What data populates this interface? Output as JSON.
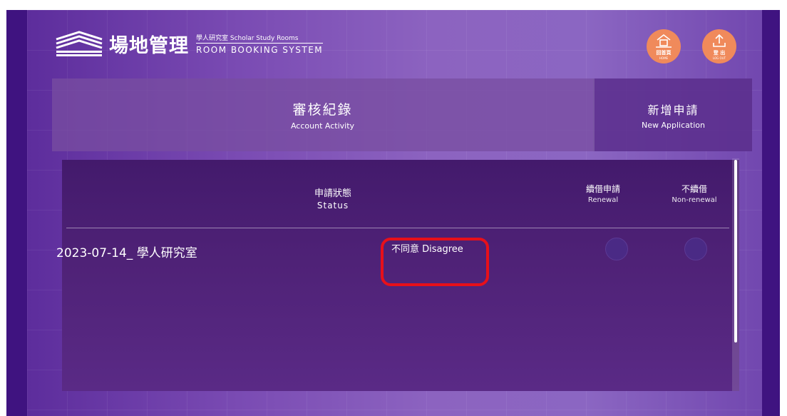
{
  "header": {
    "logo_title": "場地管理",
    "logo_subtitle": "學人研究室 Scholar Study Rooms",
    "logo_system": "ROOM BOOKING SYSTEM",
    "home_label": "回首頁",
    "home_sub": "HOME",
    "logout_label": "登 出",
    "logout_sub": "LOG OUT"
  },
  "tabs": [
    {
      "label_cn": "審核紀錄",
      "label_en": "Account Activity",
      "active": true
    },
    {
      "label_cn": "新增申請",
      "label_en": "New Application",
      "active": false
    }
  ],
  "table": {
    "columns": {
      "status_cn": "申請狀態",
      "status_en": "Status",
      "renewal_cn": "續借申請",
      "renewal_en": "Renewal",
      "nonrenewal_cn": "不續借",
      "nonrenewal_en": "Non-renewal"
    },
    "rows": [
      {
        "name": "2023-07-14_ 學人研究室",
        "status": "不同意 Disagree"
      }
    ]
  },
  "colors": {
    "accent_button": "#f08a5b",
    "highlight_box": "#e8101a",
    "side_bar": "#3f1380"
  },
  "icons": {
    "home": "home-icon",
    "logout": "logout-icon"
  }
}
